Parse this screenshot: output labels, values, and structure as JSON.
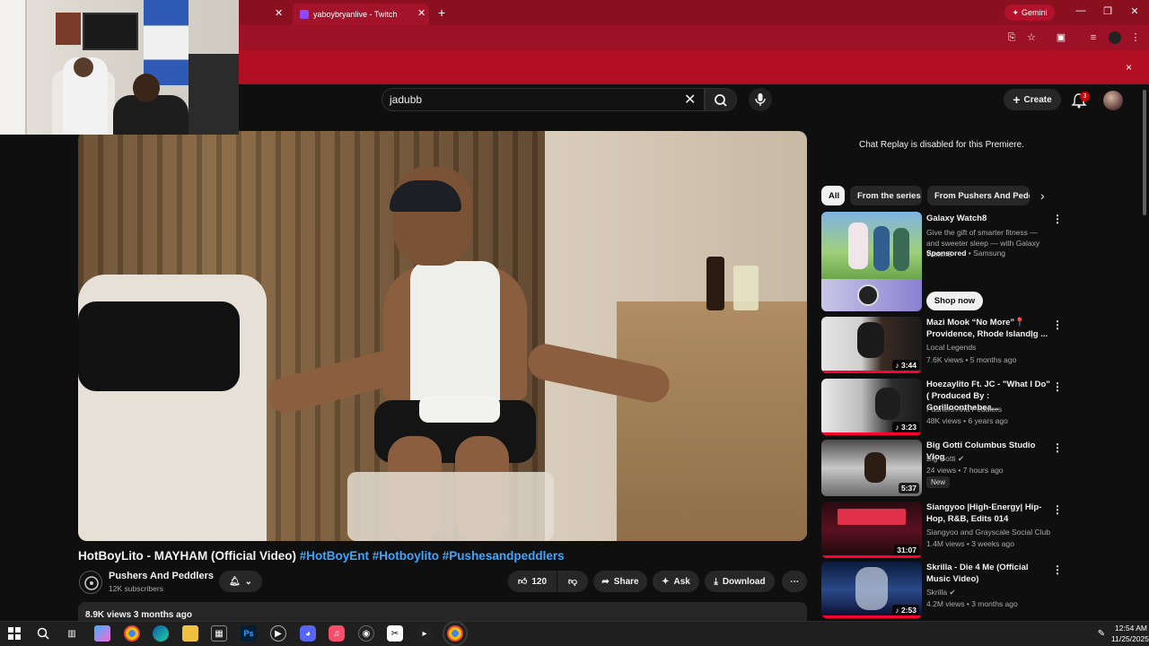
{
  "browser": {
    "tabs": [
      {
        "label": "",
        "active": false
      },
      {
        "label": "yaboybryanlive - Twitch",
        "active": true
      }
    ],
    "gemini_label": "Gemini",
    "new_tab_glyph": "+",
    "infobar_close": "×"
  },
  "youtube": {
    "search": {
      "value": "jadubb"
    },
    "create_label": "Create",
    "notification_count": "3"
  },
  "video": {
    "title": "HotBoyLito - MAYHAM (Official Video)",
    "hashtags": [
      "#HotBoyEnt",
      "#Hotboylito",
      "#Pushesandpeddlers"
    ],
    "channel": "Pushers And Peddlers",
    "subscribers": "12K subscribers",
    "likes": "120",
    "share_label": "Share",
    "ask_label": "Ask",
    "download_label": "Download",
    "views_date": "8.9K views  3 months ago"
  },
  "sidebar": {
    "chat_replay": "Chat Replay is disabled for this Premiere.",
    "chips": [
      "All",
      "From the series",
      "From Pushers And Peddlers"
    ],
    "ad": {
      "title": "Galaxy Watch8",
      "desc": "Give the gift of smarter fitness — and sweeter sleep — with Galaxy Watch8",
      "sponsored": "Sponsored",
      "advertiser": "Samsung",
      "cta": "Shop now"
    },
    "videos": [
      {
        "title": "Mazi Mook “No More”📍 Providence, Rhode Islandḷg ...",
        "channel": "Local Legends",
        "meta": "7.6K views • 5 months ago",
        "duration": "3:44",
        "progress": 1.0
      },
      {
        "title": "Hoezaylito Ft. JC - \"What I Do\" ( Produced By : Gorilloonthebea...",
        "channel": "Pushers And Peddlers",
        "meta": "48K views • 6 years ago",
        "duration": "3:23",
        "progress": 1.0
      },
      {
        "title": "Big Gotti Columbus Studio Vlog",
        "channel": "Big Gotti",
        "meta": "24 views • 7 hours ago",
        "duration": "5:37",
        "badge": "New",
        "progress": 0
      },
      {
        "title": "Siangyoo |High-Energy| Hip-Hop, R&B, Edits 014",
        "channel": "Siangyoo and Grayscale Social Club",
        "meta": "1.4M views • 3 weeks ago",
        "duration": "31:07",
        "progress": 1.0
      },
      {
        "title": "Skrilla - Die 4 Me (Official Music Video)",
        "channel": "Skrilla",
        "meta": "4.2M views • 3 months ago",
        "duration": "2:53",
        "progress": 1.0
      }
    ]
  },
  "taskbar": {
    "time": "12:54 AM",
    "date": "11/25/2025"
  }
}
